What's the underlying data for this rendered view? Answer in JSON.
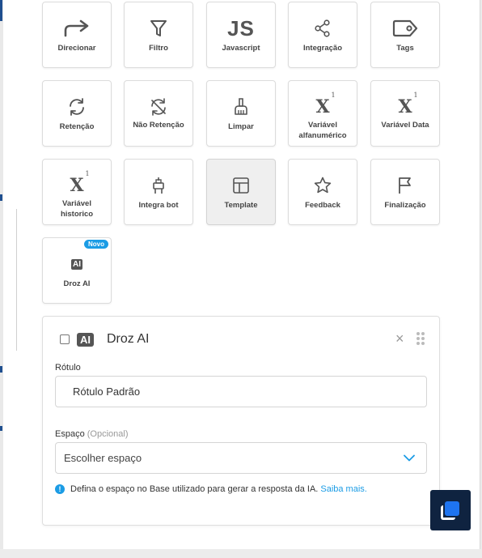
{
  "blocks": [
    {
      "label": "Direcionar",
      "icon": "redirect-arrow-icon"
    },
    {
      "label": "Filtro",
      "icon": "filter-icon"
    },
    {
      "label": "Javascript",
      "icon": "js-icon",
      "icon_text": "JS"
    },
    {
      "label": "Integração",
      "icon": "share-nodes-icon"
    },
    {
      "label": "Tags",
      "icon": "tag-icon"
    },
    {
      "label": "Retenção",
      "icon": "refresh-icon"
    },
    {
      "label": "Não Retenção",
      "icon": "no-refresh-icon"
    },
    {
      "label": "Limpar",
      "icon": "broom-icon"
    },
    {
      "label": "Variável alfanumérico",
      "icon": "variable-x-icon",
      "icon_text": "X",
      "icon_sup": "1"
    },
    {
      "label": "Variável Data",
      "icon": "variable-x-icon",
      "icon_text": "X",
      "icon_sup": "1"
    },
    {
      "label": "Variável historico",
      "icon": "variable-x-icon",
      "icon_text": "X",
      "icon_sup": "1"
    },
    {
      "label": "Integra bot",
      "icon": "robot-icon"
    },
    {
      "label": "Template",
      "icon": "template-layout-icon",
      "active": true
    },
    {
      "label": "Feedback",
      "icon": "star-icon"
    },
    {
      "label": "Finalização",
      "icon": "flag-icon"
    },
    {
      "label": "Droz AI",
      "icon": "ai-icon",
      "icon_text": "AI",
      "badge": "Novo"
    }
  ],
  "card": {
    "ai_icon_text": "AI",
    "title": "Droz AI",
    "close_symbol": "×",
    "label_field": {
      "label": "Rótulo",
      "value": "Rótulo Padrão"
    },
    "space_field": {
      "label": "Espaço",
      "optional": "(Opcional)",
      "placeholder": "Escolher espaço"
    },
    "info_icon": "!",
    "info_text": "Defina o espaço no Base utilizado para gerar a resposta da IA.",
    "info_link": "Saiba mais."
  },
  "colors": {
    "accent": "#1b9ce5",
    "fab_bg": "#0f2340",
    "fab_square": "#1e74f0"
  }
}
